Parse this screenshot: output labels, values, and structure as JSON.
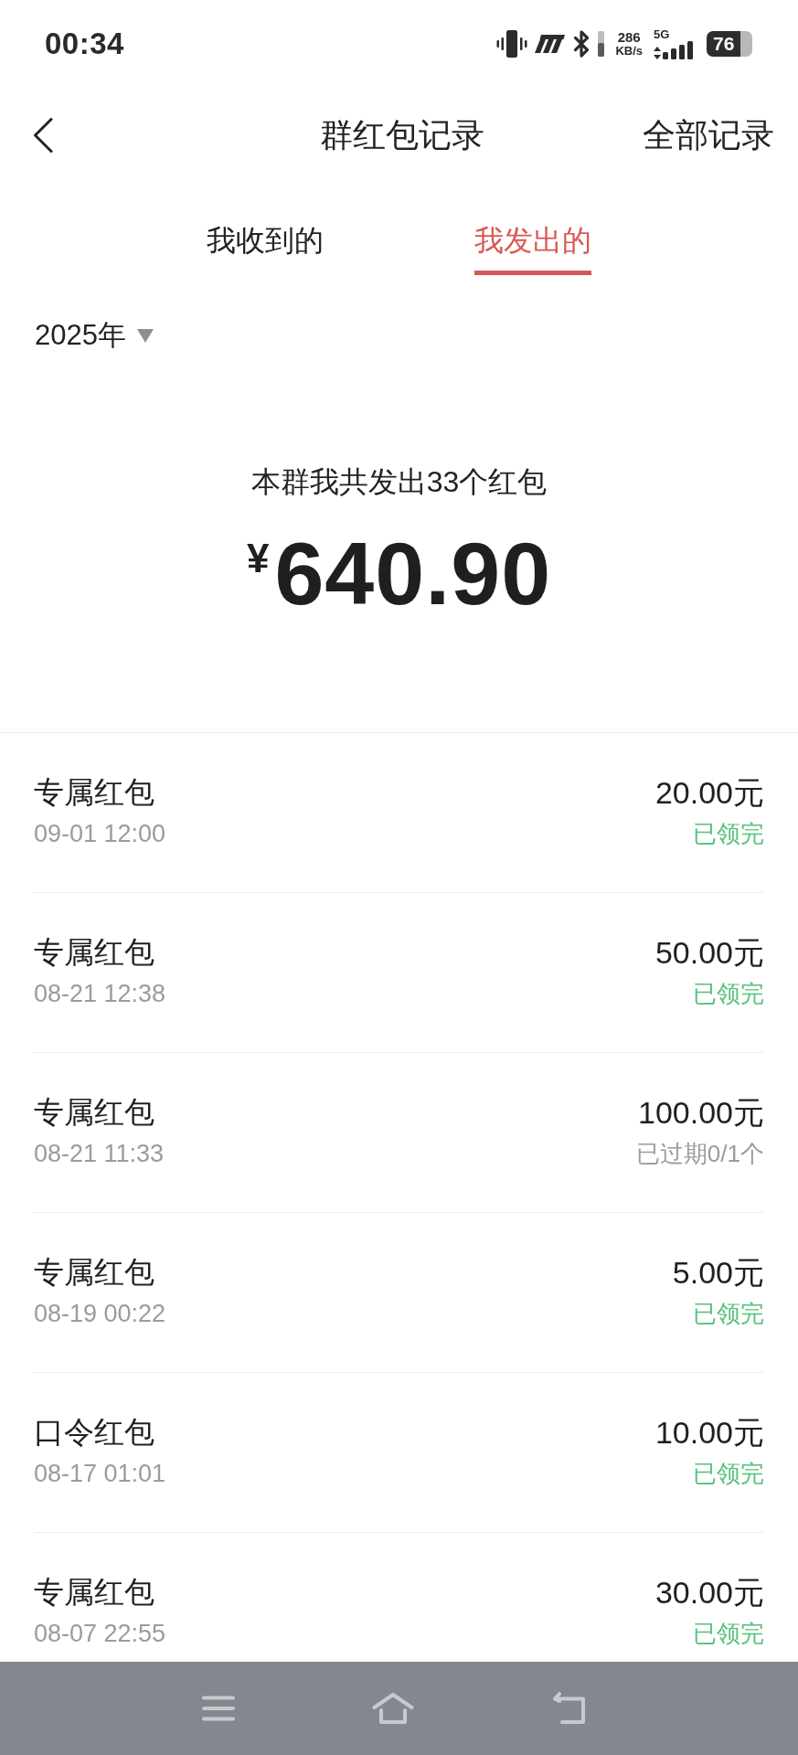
{
  "status_bar": {
    "time": "00:34",
    "net_speed": "286",
    "net_speed_unit": "KB/s",
    "network_type": "5G",
    "battery": "76"
  },
  "header": {
    "title": "群红包记录",
    "action": "全部记录"
  },
  "tabs": [
    {
      "label": "我收到的",
      "selected": false
    },
    {
      "label": "我发出的",
      "selected": true
    }
  ],
  "year_filter": {
    "label": "2025年"
  },
  "summary": {
    "caption": "本群我共发出33个红包",
    "currency": "¥",
    "amount": "640.90"
  },
  "records": [
    {
      "name": "专属红包",
      "time": "09-01 12:00",
      "amount": "20.00元",
      "status": "已领完",
      "kind": "claimed"
    },
    {
      "name": "专属红包",
      "time": "08-21 12:38",
      "amount": "50.00元",
      "status": "已领完",
      "kind": "claimed"
    },
    {
      "name": "专属红包",
      "time": "08-21 11:33",
      "amount": "100.00元",
      "status": "已过期0/1个",
      "kind": "expired"
    },
    {
      "name": "专属红包",
      "time": "08-19 00:22",
      "amount": "5.00元",
      "status": "已领完",
      "kind": "claimed"
    },
    {
      "name": "口令红包",
      "time": "08-17 01:01",
      "amount": "10.00元",
      "status": "已领完",
      "kind": "claimed"
    },
    {
      "name": "专属红包",
      "time": "08-07 22:55",
      "amount": "30.00元",
      "status": "已领完",
      "kind": "claimed"
    }
  ]
}
